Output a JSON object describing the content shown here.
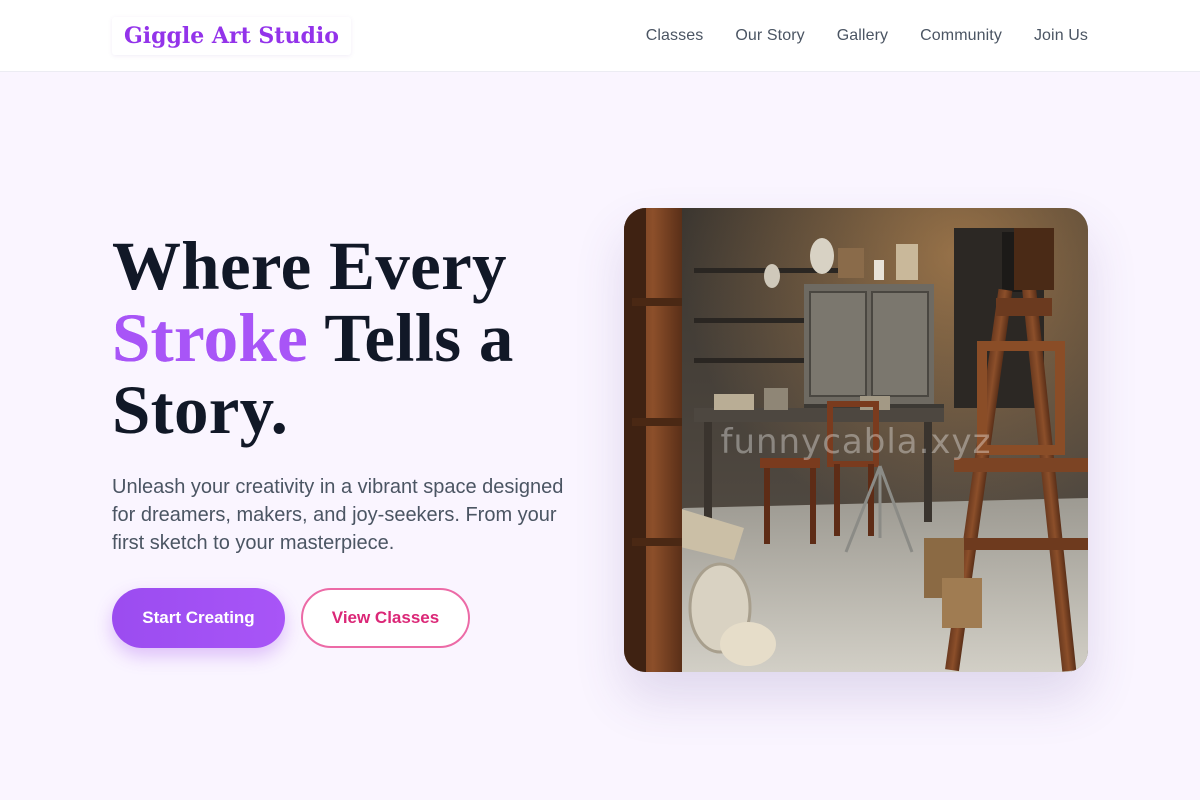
{
  "header": {
    "logo": "Giggle Art Studio",
    "nav": [
      "Classes",
      "Our Story",
      "Gallery",
      "Community",
      "Join Us"
    ]
  },
  "hero": {
    "headline_line1": "Where Every",
    "headline_accent": "Stroke",
    "headline_line2_rest": "Tells a",
    "headline_line3": "Story.",
    "subtitle": "Unleash your creativity in a vibrant space designed for dreamers, makers, and joy-seekers. From your first sketch to your masterpiece.",
    "primary_button": "Start Creating",
    "secondary_button": "View Classes",
    "image_watermark": "funnycabla.xyz"
  },
  "colors": {
    "brand_purple": "#9333ea",
    "accent_pink": "#db2777",
    "background": "#faf5ff",
    "heading": "#111827"
  }
}
